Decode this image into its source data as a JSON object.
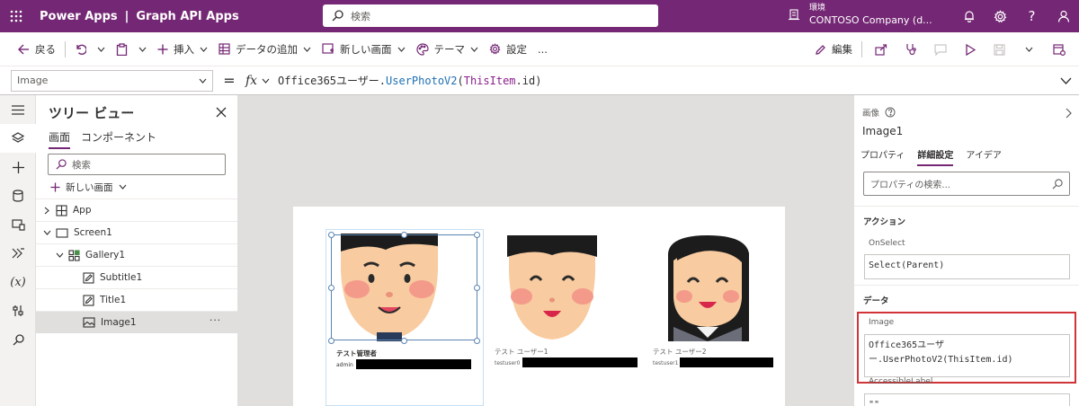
{
  "topbar": {
    "app_name": "Power Apps",
    "separator": "|",
    "app_title": "Graph API Apps",
    "search_placeholder": "検索",
    "env_label": "環境",
    "env_name": "CONTOSO Company (d..."
  },
  "command_bar": {
    "back": "戻る",
    "insert": "挿入",
    "add_data": "データの追加",
    "new_screen": "新しい画面",
    "theme": "テーマ",
    "settings": "設定",
    "more": "...",
    "edit": "編集"
  },
  "formula_bar": {
    "property": "Image",
    "equals": "=",
    "fx": "fx",
    "formula_obj": "Office365ユーザー.",
    "formula_fn": "UserPhotoV2",
    "formula_open": "(",
    "formula_arg": "ThisItem",
    "formula_rest": ".id)"
  },
  "tree_view": {
    "title": "ツリー ビュー",
    "tabs": [
      "画面",
      "コンポーネント"
    ],
    "search_placeholder": "検索",
    "new_screen": "新しい画面",
    "nodes": [
      "App",
      "Screen1",
      "Gallery1",
      "Subtitle1",
      "Title1",
      "Image1"
    ],
    "more": "···"
  },
  "gallery": {
    "cards": [
      {
        "title": "テスト管理者",
        "subtitle": "admin"
      },
      {
        "title": "テスト ユーザー1",
        "subtitle": "testuser0"
      },
      {
        "title": "テスト ユーザー2",
        "subtitle": "testuser1"
      }
    ]
  },
  "properties": {
    "control_type": "画像",
    "control_name": "Image1",
    "tabs": [
      "プロパティ",
      "詳細設定",
      "アイデア"
    ],
    "search_placeholder": "プロパティの検索...",
    "section_action": "アクション",
    "onselect_label": "OnSelect",
    "onselect_value": "Select(Parent)",
    "section_data": "データ",
    "image_label": "Image",
    "image_value_line1": "Office365ユーザ",
    "image_value_line2": "ー.UserPhotoV2(ThisItem.id)",
    "accessible_label": "AccessibleLabel",
    "accessible_value": "\"\""
  },
  "colors": {
    "brand": "#742774",
    "highlight": "#d13438",
    "function_blue": "#1f6fb2"
  }
}
